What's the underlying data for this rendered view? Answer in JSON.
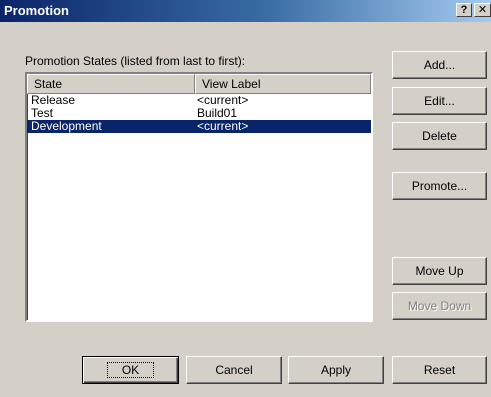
{
  "window": {
    "title": "Promotion",
    "help_label": "?",
    "close_label": "✕"
  },
  "states_group": {
    "label": "Promotion States (listed from last to first):",
    "columns": [
      "State",
      "View Label"
    ],
    "rows": [
      {
        "state": "Release",
        "view_label": "<current>",
        "selected": false
      },
      {
        "state": "Test",
        "view_label": "Build01",
        "selected": false
      },
      {
        "state": "Development",
        "view_label": "<current>",
        "selected": true
      }
    ]
  },
  "side_buttons": {
    "add": "Add...",
    "edit": "Edit...",
    "delete": "Delete",
    "promote": "Promote...",
    "move_up": "Move Up",
    "move_down": "Move Down"
  },
  "bottom_buttons": {
    "ok": "OK",
    "cancel": "Cancel",
    "apply": "Apply",
    "reset": "Reset"
  }
}
